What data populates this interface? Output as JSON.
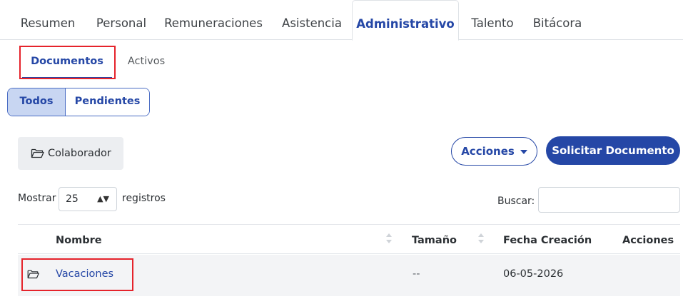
{
  "top_tabs": [
    {
      "label": "Resumen",
      "active": false
    },
    {
      "label": "Personal",
      "active": false
    },
    {
      "label": "Remuneraciones",
      "active": false
    },
    {
      "label": "Asistencia",
      "active": false
    },
    {
      "label": "Administrativo",
      "active": true
    },
    {
      "label": "Talento",
      "active": false
    },
    {
      "label": "Bitácora",
      "active": false
    }
  ],
  "sub_tabs": [
    {
      "label": "Documentos",
      "active": true
    },
    {
      "label": "Activos",
      "active": false
    }
  ],
  "filter_toggle": {
    "todos": "Todos",
    "pendientes": "Pendientes",
    "selected": "Todos"
  },
  "folder_button": {
    "label": "Colaborador",
    "icon": "folder-open-icon"
  },
  "actions": {
    "acciones_label": "Acciones",
    "solicitar_label": "Solicitar Documento"
  },
  "length_control": {
    "prefix": "Mostrar",
    "value": "25",
    "suffix": "registros"
  },
  "search": {
    "label": "Buscar:",
    "value": ""
  },
  "table": {
    "columns": [
      "",
      "Nombre",
      "Tamaño",
      "Fecha Creación",
      "Acciones"
    ],
    "rows": [
      {
        "icon": "folder-open-icon",
        "nombre": "Vacaciones",
        "tamano": "--",
        "fecha": "06-05-2026",
        "acciones": ""
      }
    ]
  },
  "colors": {
    "accent": "#2547a6",
    "highlight_box": "#e5232b",
    "toggle_active_bg": "#c8d6f2"
  }
}
